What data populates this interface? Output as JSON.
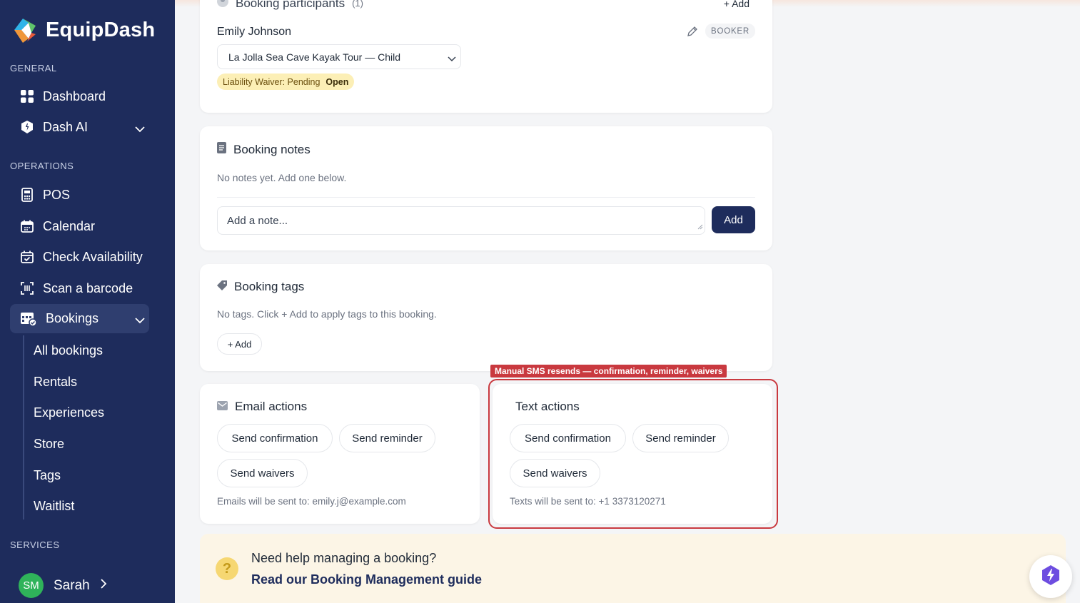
{
  "app": {
    "name": "EquipDash"
  },
  "sidebar": {
    "sections": {
      "general": "GENERAL",
      "operations": "OPERATIONS",
      "services": "SERVICES"
    },
    "items": {
      "dashboard": "Dashboard",
      "dash_ai": "Dash AI",
      "pos": "POS",
      "calendar": "Calendar",
      "check_availability": "Check Availability",
      "scan_barcode": "Scan a barcode",
      "bookings": "Bookings"
    },
    "bookings_sub": [
      "All bookings",
      "Rentals",
      "Experiences",
      "Store",
      "Tags",
      "Waitlist"
    ],
    "user": {
      "initials": "SM",
      "name": "Sarah"
    }
  },
  "participants": {
    "title": "Booking participants",
    "count": "(1)",
    "add_label": "+ Add",
    "name": "Emily Johnson",
    "role": "BOOKER",
    "selected_option": "La Jolla Sea Cave Kayak Tour — Child",
    "waiver_label": "Liability Waiver: Pending",
    "waiver_action": "Open"
  },
  "notes": {
    "title": "Booking notes",
    "empty": "No notes yet. Add one below.",
    "placeholder": "Add a note...",
    "add_button": "Add"
  },
  "tags": {
    "title": "Booking tags",
    "empty": "No tags. Click + Add to apply tags to this booking.",
    "add_button": "+ Add"
  },
  "email_actions": {
    "title": "Email actions",
    "buttons": [
      "Send confirmation",
      "Send reminder",
      "Send waivers"
    ],
    "recipient": "Emails will be sent to: emily.j@example.com"
  },
  "text_actions": {
    "badge": "Manual SMS resends — confirmation, reminder, waivers",
    "title": "Text actions",
    "buttons": [
      "Send confirmation",
      "Send reminder",
      "Send waivers"
    ],
    "recipient": "Texts will be sent to: +1 3373120271"
  },
  "help": {
    "icon": "?",
    "question": "Need help managing a booking?",
    "link": "Read our Booking Management guide"
  },
  "colors": {
    "sidebar": "#1e2c5c",
    "accent": "#1e2c5c",
    "highlight": "#c9393f",
    "waiver": "#fcefb6"
  }
}
